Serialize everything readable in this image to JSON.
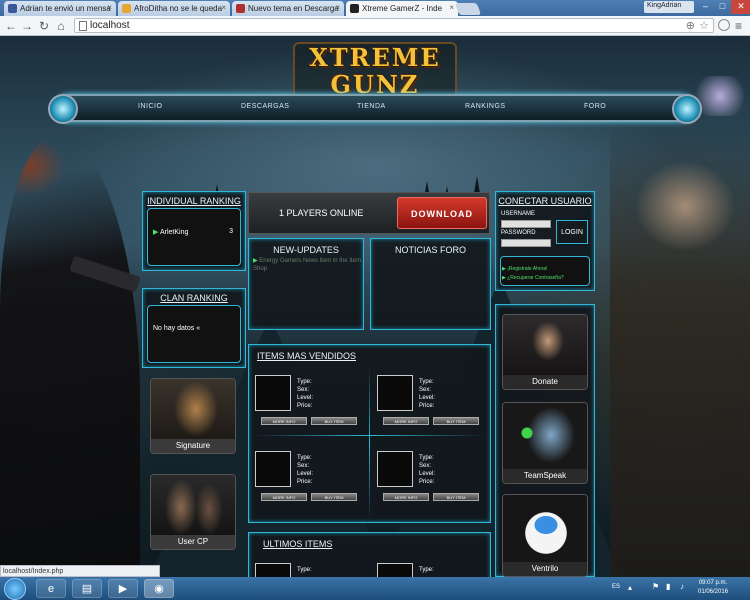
{
  "browser": {
    "tabs": [
      {
        "title": "Adrian te envió un mensa",
        "favicon_color": "#3b5998"
      },
      {
        "title": "AfroDitha no se le queda",
        "favicon_color": "#e8a530"
      },
      {
        "title": "Nuevo tema en Descarga",
        "favicon_color": "#b03030"
      },
      {
        "title": "Xtreme GamerZ - Inde",
        "favicon_color": "#222222"
      }
    ],
    "user": "KingAdrian",
    "url": "localhost",
    "status_url": "localhost/Index.php",
    "icons": {
      "back": "back-arrow-icon",
      "forward": "forward-arrow-icon",
      "reload": "reload-icon",
      "home": "home-icon",
      "star": "star-icon",
      "menu": "menu-icon"
    }
  },
  "site": {
    "logo_line1": "XTREME",
    "logo_line2": "GUNZ",
    "nav": [
      "INICIO",
      "DESCARGAS",
      "TIENDA",
      "RANKINGS",
      "FORO"
    ],
    "ranking": {
      "title": "INDIVIDUAL RANKING",
      "rows": [
        {
          "name": "ArletKing",
          "score": "3"
        }
      ]
    },
    "clan": {
      "title": "CLAN RANKING",
      "empty": "No hay datos «"
    },
    "players_online": "1 PLAYERS ONLINE",
    "download_label": "DOWNLOAD",
    "updates": {
      "title": "NEW-UPDATES",
      "items": [
        "Energy Gamers News Item in the Item Shop"
      ]
    },
    "noticias": {
      "title": "NOTICIAS FORO"
    },
    "login": {
      "title": "CONECTAR USUARIO",
      "username_label": "USERNAME",
      "password_label": "PASSWORD",
      "button": "LOGIN",
      "register": "¡Registrate Ahora!",
      "recover": "¿Recuperar Contraseña?"
    },
    "signature_label": "Signature",
    "usercp_label": "User CP",
    "top_items": {
      "title": "ITEMS MAS VENDIDOS",
      "stats": [
        "Type:",
        "Sex:",
        "Level:",
        "Price:"
      ],
      "more_info": "MORE INFO",
      "buy_item": "BUY ITEM"
    },
    "latest_items": {
      "title": "ULTIMOS ITEMS"
    },
    "right_cards": [
      "Donate",
      "TeamSpeak",
      "Ventrilo"
    ]
  },
  "taskbar": {
    "lang": "ES",
    "time": "09:07 p.m.",
    "date": "01/06/2016"
  }
}
